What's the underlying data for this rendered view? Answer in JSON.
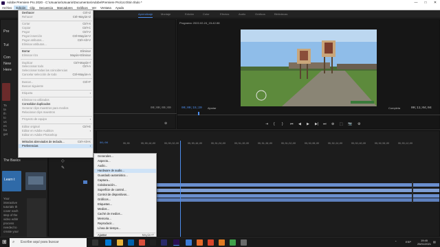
{
  "window": {
    "title": "Adobe Premiere Pro 2020 - C:\\Usuarios\\Usuario\\Documentos\\Adobe\\Premiere Pro\\14.0\\Sin título *",
    "controls": [
      "—",
      "□",
      "✕"
    ]
  },
  "menubar": {
    "items": [
      "Archivo",
      "Edición",
      "Clip",
      "Secuencia",
      "Marcadores",
      "Gráficos",
      "Ver",
      "Ventana",
      "Ayuda"
    ]
  },
  "workspaces": [
    "Aprendizaje",
    "Montaje",
    "Edición",
    "Color",
    "Efectos",
    "Audio",
    "Gráficos",
    "Bibliotecas"
  ],
  "learn_panel": {
    "fragments": [
      "Pre",
      "Tut",
      "Con",
      "New",
      "Here"
    ],
    "side_text": [
      "Ta",
      "ta",
      "th",
      "to",
      "us",
      "es",
      "ha",
      "get"
    ],
    "section_title": "The Basics",
    "card_label": "Learn t",
    "description": [
      "Your",
      "interactive",
      "tutorials th",
      "cover each",
      "step of the",
      "video editir",
      "process",
      "needed to",
      "create your"
    ]
  },
  "source_panel": {
    "timecode": "00;00;00;00"
  },
  "program_panel": {
    "title": "Programa: 2022-02-24_15-42-58",
    "timecode_left": "00;00;15;20",
    "fit_label": "Ajustar",
    "quality": "Completa",
    "timecode_right": "00;11;04;04",
    "transport": [
      "⇥",
      "{",
      "}",
      "⏮",
      "◀",
      "▶",
      "▶|",
      "⏭",
      "⊕",
      "⬚",
      "📷",
      "⚙"
    ]
  },
  "timeline": {
    "ruler": [
      "00;00",
      "00;00;16;00",
      "00;00;32;00",
      "00;00;48;00",
      "00;01;04;00",
      "00;01;20;00",
      "00;01;36;00",
      "00;01;52;00",
      "00;02;08;00",
      "00;02;24;00",
      "00;02;40;00",
      "00;02;56;00",
      "00;03;12;00"
    ],
    "start_label": "00;00"
  },
  "edit_menu": {
    "items": [
      {
        "label": "Deshacer",
        "shortcut": "Ctrl+Z",
        "enabled": true
      },
      {
        "label": "Rehacer",
        "shortcut": "Ctrl+Mayús+Z",
        "enabled": false
      },
      {
        "sep": true
      },
      {
        "label": "Cortar",
        "shortcut": "Ctrl+X",
        "enabled": false
      },
      {
        "label": "Copiar",
        "shortcut": "Ctrl+C",
        "enabled": false
      },
      {
        "label": "Pegar",
        "shortcut": "Ctrl+V",
        "enabled": false
      },
      {
        "label": "Pegar inserción",
        "shortcut": "Ctrl+Mayús+V",
        "enabled": false
      },
      {
        "label": "Pegar atributos...",
        "shortcut": "Ctrl+Alt+V",
        "enabled": false
      },
      {
        "label": "Eliminar atributos...",
        "shortcut": "",
        "enabled": false
      },
      {
        "sep": true
      },
      {
        "label": "Borrar",
        "shortcut": "Eliminar",
        "enabled": true
      },
      {
        "label": "Eliminar rizo",
        "shortcut": "Mayús+Eliminar",
        "enabled": false
      },
      {
        "sep": true
      },
      {
        "label": "Duplicar",
        "shortcut": "Ctrl+Mayús+/",
        "enabled": false
      },
      {
        "label": "Seleccionar todo",
        "shortcut": "Ctrl+A",
        "enabled": false
      },
      {
        "label": "Seleccionar todas las coincidencias",
        "shortcut": "",
        "enabled": false
      },
      {
        "label": "Cancelar selección de todo",
        "shortcut": "Ctrl+Mayús+A",
        "enabled": false
      },
      {
        "sep": true
      },
      {
        "label": "Buscar...",
        "shortcut": "Ctrl+F",
        "enabled": false
      },
      {
        "label": "Buscar siguiente",
        "shortcut": "",
        "enabled": false
      },
      {
        "sep": true
      },
      {
        "label": "Etiqueta",
        "shortcut": "",
        "enabled": false,
        "submenu": true
      },
      {
        "sep": true
      },
      {
        "label": "Eliminar no utilizados",
        "shortcut": "",
        "enabled": false
      },
      {
        "label": "Consolidar duplicados",
        "shortcut": "",
        "enabled": true
      },
      {
        "label": "Generar clips maestros para medios",
        "shortcut": "",
        "enabled": false
      },
      {
        "label": "Relacionar clips maestros",
        "shortcut": "",
        "enabled": false
      },
      {
        "sep": true
      },
      {
        "label": "Proyecto de equipo",
        "shortcut": "",
        "enabled": false,
        "submenu": true
      },
      {
        "sep": true
      },
      {
        "label": "Editar original",
        "shortcut": "Ctrl+E",
        "enabled": false
      },
      {
        "label": "Editar en Adobe Audition",
        "shortcut": "",
        "enabled": false,
        "submenu": true
      },
      {
        "label": "Editar en Adobe Photoshop",
        "shortcut": "",
        "enabled": false
      },
      {
        "sep": true
      },
      {
        "label": "Métodos abreviados de teclado...",
        "shortcut": "Ctrl+Alt+K",
        "enabled": true
      },
      {
        "label": "Preferencias",
        "shortcut": "",
        "enabled": true,
        "submenu": true,
        "selected": true
      }
    ]
  },
  "pref_menu": {
    "items": [
      {
        "label": "Generales..."
      },
      {
        "label": "Aspecto..."
      },
      {
        "label": "Audio..."
      },
      {
        "label": "Hardware de audio...",
        "selected": true
      },
      {
        "label": "Guardado automático..."
      },
      {
        "label": "Captura..."
      },
      {
        "label": "Colaboración..."
      },
      {
        "label": "Superficie de control..."
      },
      {
        "label": "Control de dispositivos..."
      },
      {
        "label": "Gráficos..."
      },
      {
        "label": "Etiquetas..."
      },
      {
        "label": "Medios..."
      },
      {
        "label": "Caché de medios..."
      },
      {
        "label": "Memoria..."
      },
      {
        "label": "Reproducir..."
      },
      {
        "label": "Línea de tiempo..."
      },
      {
        "sep": true
      },
      {
        "label": "Ajustar",
        "shortcut": "Mayús+T"
      }
    ]
  },
  "taskbar": {
    "search_placeholder": "Escribe aquí para buscar",
    "time": "19:45",
    "date": "25/01/2021",
    "lang": "ESP"
  },
  "colors": {
    "accent": "#4e8ff0",
    "menu_selected": "#cfe3f7",
    "clip_blue": "#4f7dc6",
    "sky": "#8fbde9",
    "grass": "#5d8a3c"
  }
}
